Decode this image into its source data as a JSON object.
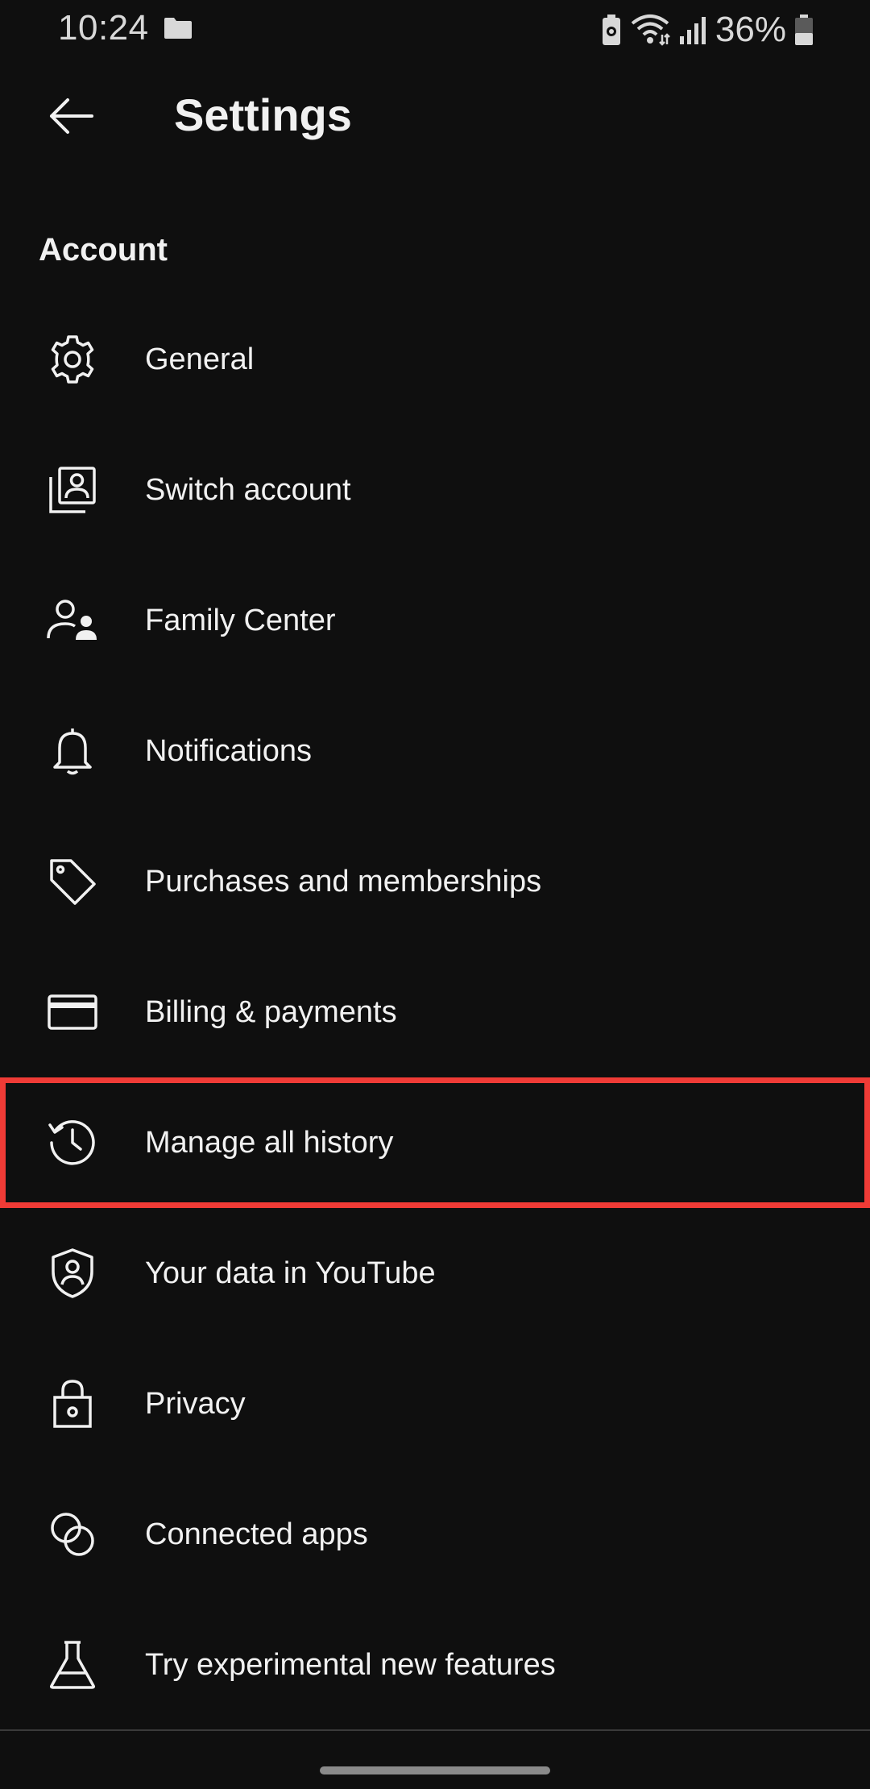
{
  "status_bar": {
    "time": "10:24",
    "battery_percent": "36%",
    "icons": [
      "folder-icon",
      "battery-saver-icon",
      "wifi-icon",
      "cellular-signal-icon",
      "battery-icon"
    ]
  },
  "app_bar": {
    "title": "Settings",
    "back_icon": "arrow-left-icon"
  },
  "section": {
    "title": "Account"
  },
  "items": [
    {
      "label": "General",
      "icon": "gear-icon"
    },
    {
      "label": "Switch account",
      "icon": "switch-account-icon"
    },
    {
      "label": "Family Center",
      "icon": "family-icon"
    },
    {
      "label": "Notifications",
      "icon": "bell-icon"
    },
    {
      "label": "Purchases and memberships",
      "icon": "tag-icon"
    },
    {
      "label": "Billing & payments",
      "icon": "credit-card-icon"
    },
    {
      "label": "Manage all history",
      "icon": "history-icon",
      "highlighted": true
    },
    {
      "label": "Your data in YouTube",
      "icon": "shield-person-icon"
    },
    {
      "label": "Privacy",
      "icon": "lock-icon"
    },
    {
      "label": "Connected apps",
      "icon": "connected-apps-icon"
    },
    {
      "label": "Try experimental new features",
      "icon": "flask-icon"
    }
  ],
  "colors": {
    "background": "#0f0f0f",
    "text": "#f1f1f1",
    "highlight_outline": "#ef3b36"
  }
}
